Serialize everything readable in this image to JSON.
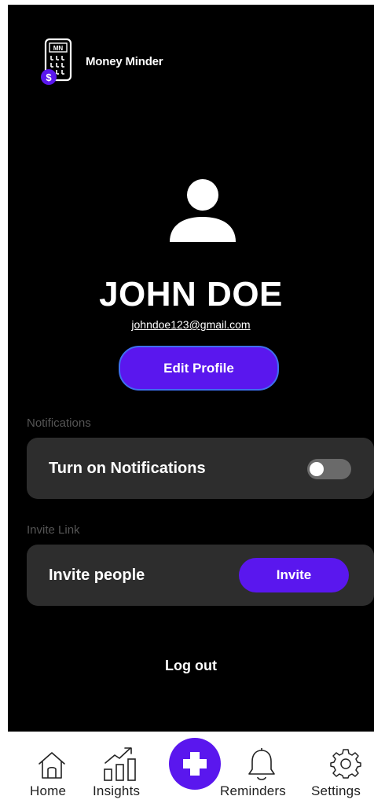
{
  "app": {
    "title": "Money Minder",
    "logo_text": "MN",
    "logo_badge": "$"
  },
  "profile": {
    "name": "JOHN DOE",
    "email": "johndoe123@gmail.com",
    "edit_label": "Edit Profile"
  },
  "notifications": {
    "section_label": "Notifications",
    "toggle_label": "Turn on Notifications",
    "enabled": false
  },
  "invite": {
    "section_label": "Invite Link",
    "label": "Invite people",
    "button_label": "Invite"
  },
  "logout_label": "Log out",
  "nav": {
    "home": "Home",
    "insights": "Insights",
    "reminders": "Reminders",
    "settings": "Settings"
  },
  "colors": {
    "accent": "#5a17ee",
    "background": "#000000",
    "card": "#2d2d2d"
  }
}
